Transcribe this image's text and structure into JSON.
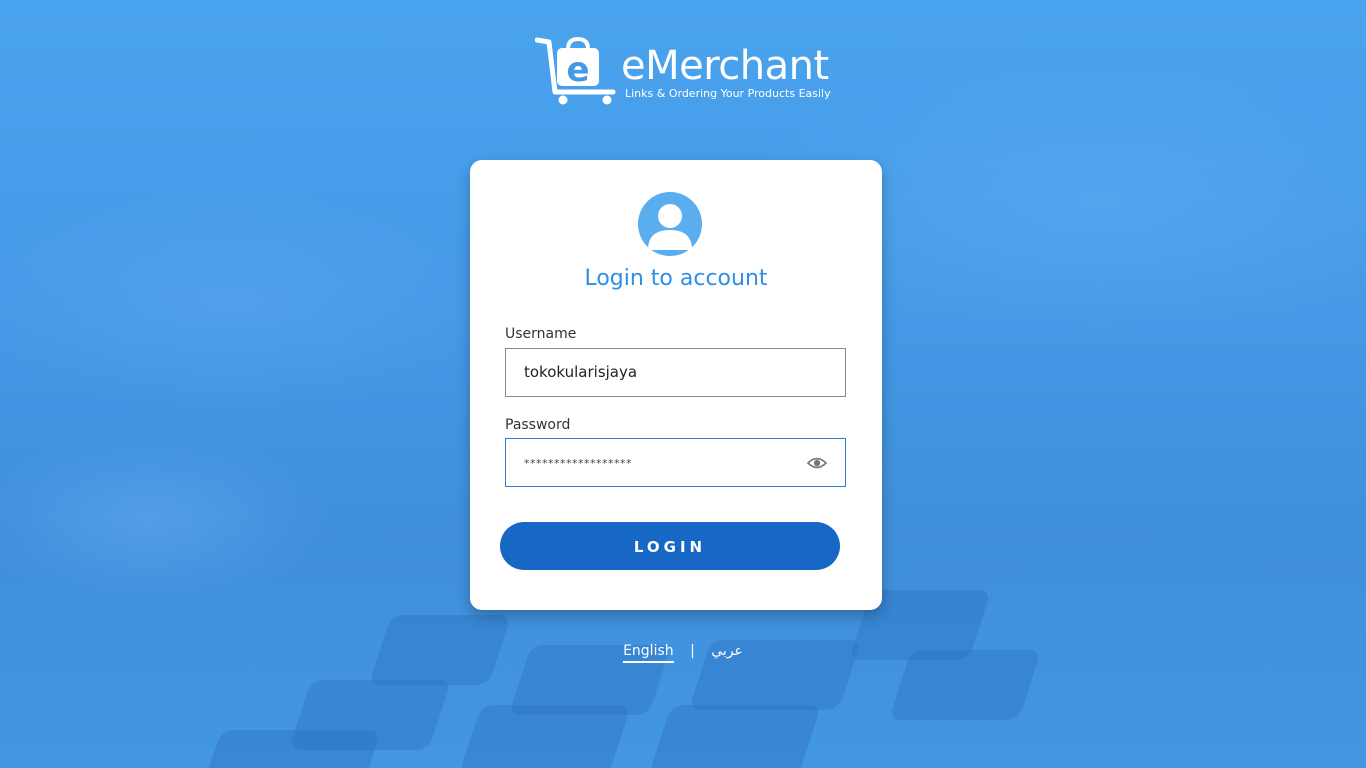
{
  "brand": {
    "name": "eMerchant",
    "tagline": "Links & Ordering Your Products Easily"
  },
  "login": {
    "title": "Login to account",
    "username_label": "Username",
    "username_value": "tokokularisjaya",
    "password_label": "Password",
    "password_masked": "******************",
    "submit_label": "LOGIN"
  },
  "language": {
    "options": [
      "English",
      "عربي"
    ],
    "selected": "English",
    "separator": "|"
  },
  "colors": {
    "background": "#4599e6",
    "accent": "#2f8fe6",
    "button": "#1767c4",
    "card": "#ffffff"
  },
  "icons": {
    "logo": "shopping-cart-e-icon",
    "avatar": "user-avatar-icon",
    "toggle_password": "eye-icon"
  }
}
